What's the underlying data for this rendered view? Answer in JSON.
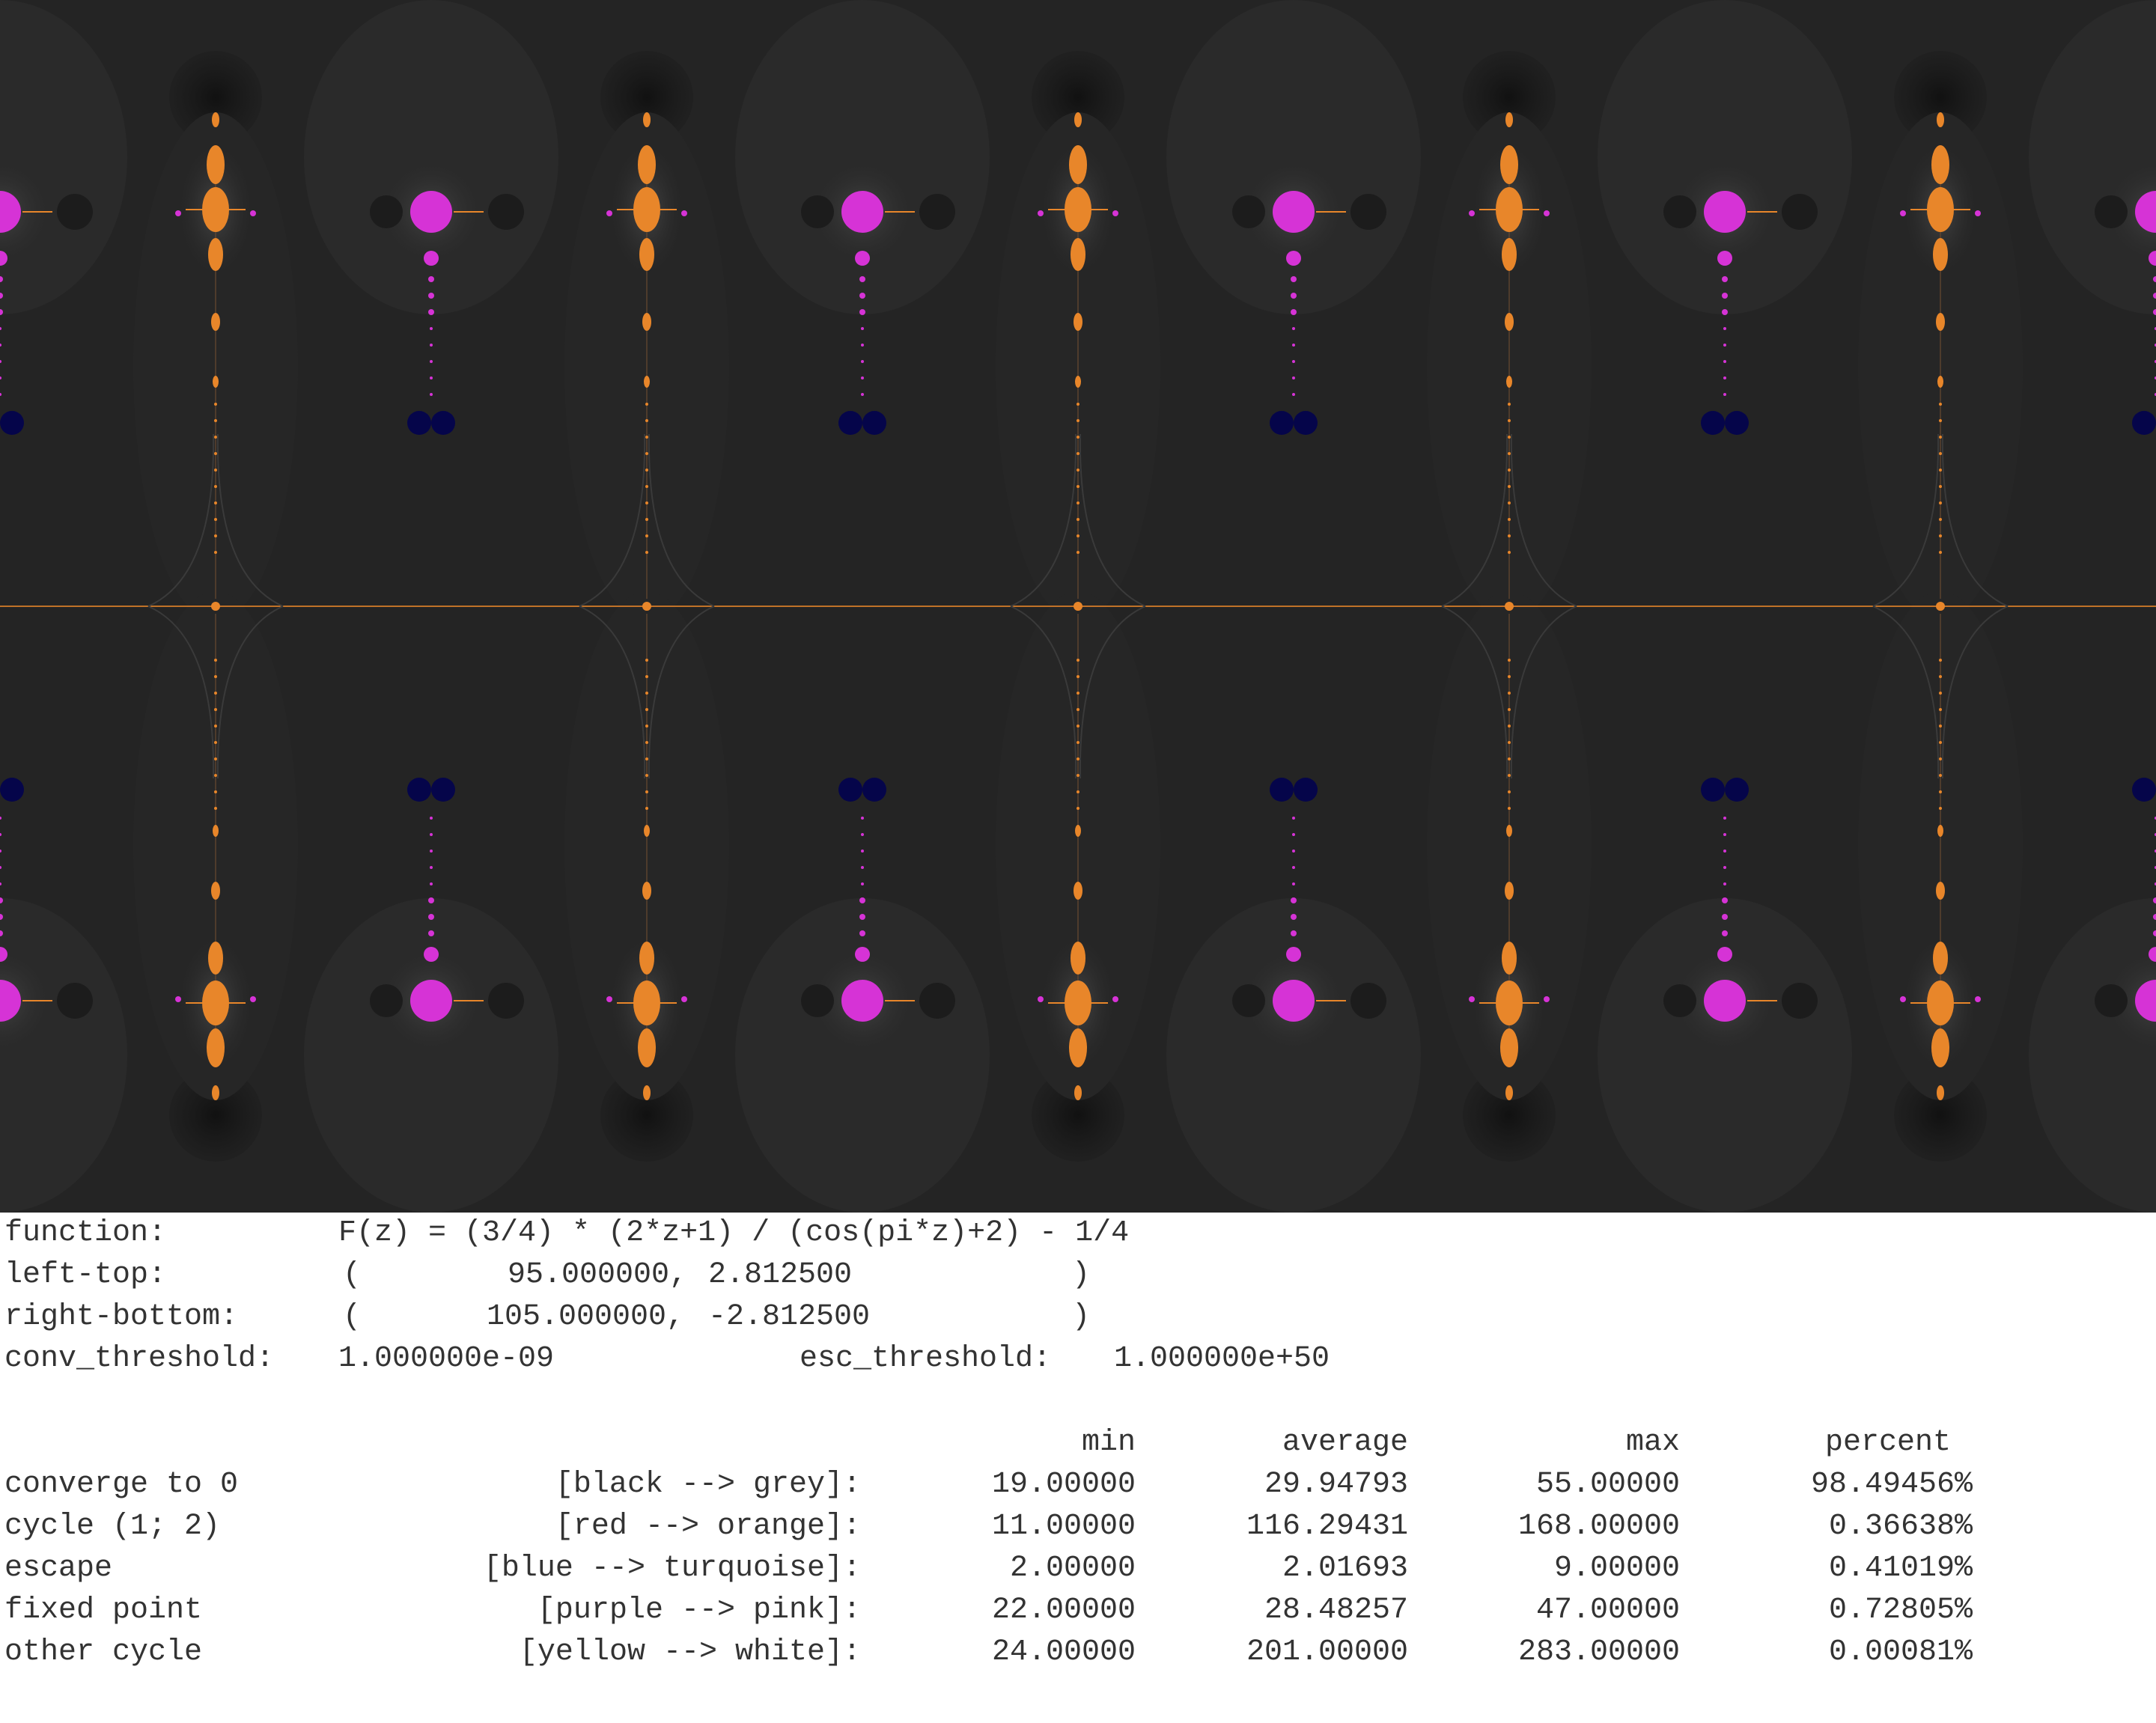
{
  "params": {
    "function_label": "function:",
    "function_value": "F(z) = (3/4) * (2*z+1) / (cos(pi*z)+2) - 1/4",
    "left_top_label": "left-top:",
    "left_top_open": "(",
    "left_top_x": "95.000000,",
    "left_top_y": "2.812500",
    "left_top_close": ")",
    "right_bottom_label": "right-bottom:",
    "right_bottom_open": "(",
    "right_bottom_x": "105.000000,",
    "right_bottom_y": "-2.812500",
    "right_bottom_close": ")",
    "conv_threshold_label": "conv_threshold:",
    "conv_threshold_value": "1.000000e-09",
    "esc_threshold_label": "esc_threshold:",
    "esc_threshold_value": "1.000000e+50"
  },
  "stats_table": {
    "headers": [
      "min",
      "average",
      "max",
      "percent"
    ],
    "rows": [
      {
        "name": "converge to 0",
        "colors": "[black --> grey]:",
        "min": "19.00000",
        "average": "29.94793",
        "max": "55.00000",
        "percent": "98.49456%"
      },
      {
        "name": "cycle (1; 2)",
        "colors": "[red --> orange]:",
        "min": "11.00000",
        "average": "116.29431",
        "max": "168.00000",
        "percent": "0.36638%"
      },
      {
        "name": "escape",
        "colors": "[blue --> turquoise]:",
        "min": "2.00000",
        "average": "2.01693",
        "max": "9.00000",
        "percent": "0.41019%"
      },
      {
        "name": "fixed point",
        "colors": "[purple --> pink]:",
        "min": "22.00000",
        "average": "28.48257",
        "max": "47.00000",
        "percent": "0.72805%"
      },
      {
        "name": "other cycle",
        "colors": "[yellow --> white]:",
        "min": "24.00000",
        "average": "201.00000",
        "max": "283.00000",
        "percent": "0.00081%"
      }
    ]
  },
  "palette": {
    "background": "#242424",
    "converge_to_0": "#2b2b2b",
    "cycle_orange": "#e8862a",
    "fixed_point_pink": "#d633d6",
    "escape_blue": "#05054a",
    "shadow": "#1c1c1c"
  }
}
